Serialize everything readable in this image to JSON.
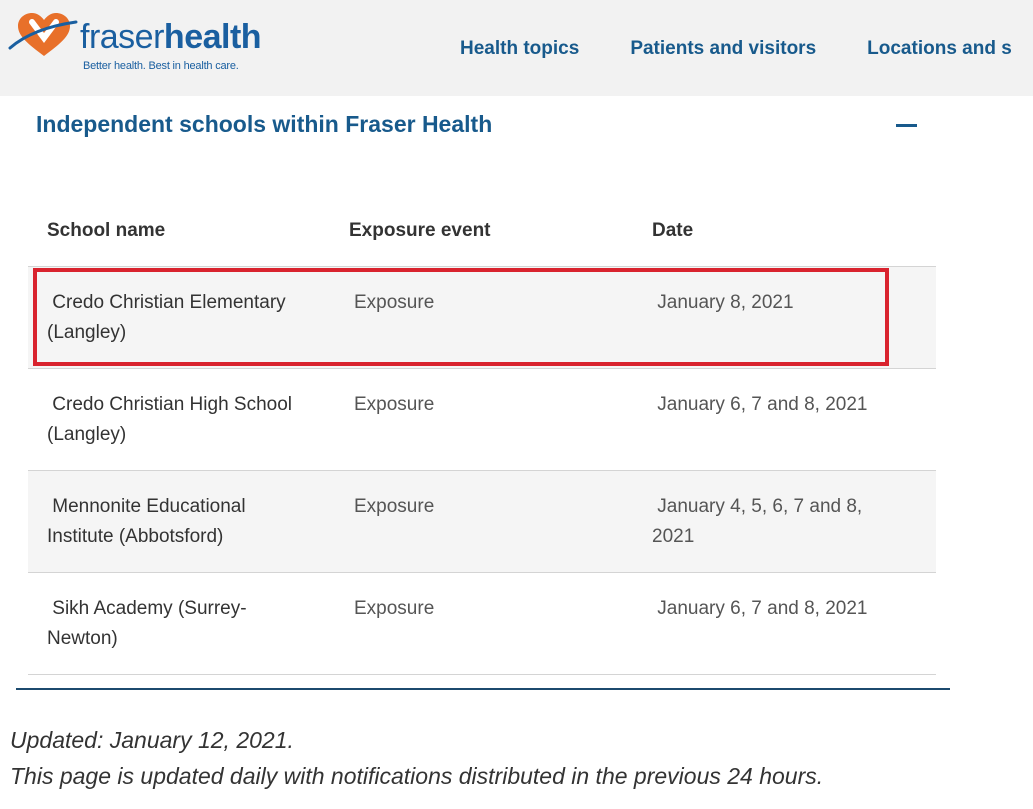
{
  "header": {
    "logo": {
      "word_light": "fraser",
      "word_bold": "health",
      "tagline": "Better health. Best in health care."
    },
    "nav": [
      "Health topics",
      "Patients and visitors",
      "Locations and s"
    ]
  },
  "section": {
    "title": "Independent schools within Fraser Health",
    "toggle_symbol": "minus"
  },
  "table": {
    "columns": [
      "School name",
      "Exposure event",
      "Date"
    ],
    "rows": [
      {
        "school_line1": "Credo Christian Elementary",
        "school_line2": "(Langley)",
        "event": "Exposure",
        "date_line1": "January 8, 2021",
        "date_line2": ""
      },
      {
        "school_line1": "Credo Christian High School",
        "school_line2": "(Langley)",
        "event": "Exposure",
        "date_line1": "January 6, 7 and 8, 2021",
        "date_line2": ""
      },
      {
        "school_line1": "Mennonite Educational",
        "school_line2": "Institute (Abbotsford)",
        "event": "Exposure",
        "date_line1": "January 4, 5, 6, 7 and 8,",
        "date_line2": "2021"
      },
      {
        "school_line1": "Sikh Academy (Surrey-",
        "school_line2": "Newton)",
        "event": "Exposure",
        "date_line1": "January 6, 7 and 8, 2021",
        "date_line2": ""
      }
    ],
    "highlighted_row": 0,
    "highlight_color": "#d9232e"
  },
  "footer": {
    "updated": "Updated: January 12, 2021.",
    "note": "This page is updated daily with notifications distributed in the previous 24 hours."
  },
  "colors": {
    "brand_blue": "#185a8c",
    "logo_orange": "#e8702a",
    "header_bg": "#f2f2f2"
  }
}
